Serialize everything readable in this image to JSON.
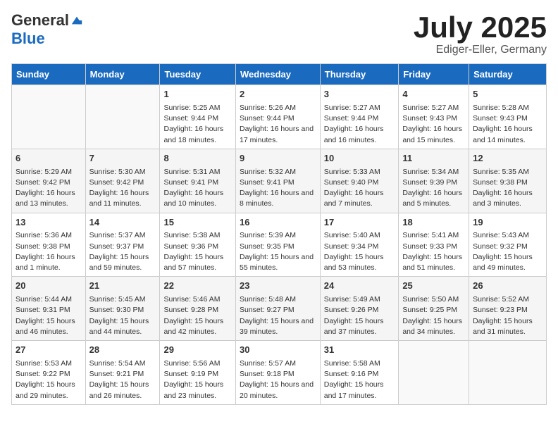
{
  "header": {
    "logo_general": "General",
    "logo_blue": "Blue",
    "title": "July 2025",
    "subtitle": "Ediger-Eller, Germany"
  },
  "days_of_week": [
    "Sunday",
    "Monday",
    "Tuesday",
    "Wednesday",
    "Thursday",
    "Friday",
    "Saturday"
  ],
  "weeks": [
    [
      {
        "day": "",
        "info": ""
      },
      {
        "day": "",
        "info": ""
      },
      {
        "day": "1",
        "info": "Sunrise: 5:25 AM\nSunset: 9:44 PM\nDaylight: 16 hours and 18 minutes."
      },
      {
        "day": "2",
        "info": "Sunrise: 5:26 AM\nSunset: 9:44 PM\nDaylight: 16 hours and 17 minutes."
      },
      {
        "day": "3",
        "info": "Sunrise: 5:27 AM\nSunset: 9:44 PM\nDaylight: 16 hours and 16 minutes."
      },
      {
        "day": "4",
        "info": "Sunrise: 5:27 AM\nSunset: 9:43 PM\nDaylight: 16 hours and 15 minutes."
      },
      {
        "day": "5",
        "info": "Sunrise: 5:28 AM\nSunset: 9:43 PM\nDaylight: 16 hours and 14 minutes."
      }
    ],
    [
      {
        "day": "6",
        "info": "Sunrise: 5:29 AM\nSunset: 9:42 PM\nDaylight: 16 hours and 13 minutes."
      },
      {
        "day": "7",
        "info": "Sunrise: 5:30 AM\nSunset: 9:42 PM\nDaylight: 16 hours and 11 minutes."
      },
      {
        "day": "8",
        "info": "Sunrise: 5:31 AM\nSunset: 9:41 PM\nDaylight: 16 hours and 10 minutes."
      },
      {
        "day": "9",
        "info": "Sunrise: 5:32 AM\nSunset: 9:41 PM\nDaylight: 16 hours and 8 minutes."
      },
      {
        "day": "10",
        "info": "Sunrise: 5:33 AM\nSunset: 9:40 PM\nDaylight: 16 hours and 7 minutes."
      },
      {
        "day": "11",
        "info": "Sunrise: 5:34 AM\nSunset: 9:39 PM\nDaylight: 16 hours and 5 minutes."
      },
      {
        "day": "12",
        "info": "Sunrise: 5:35 AM\nSunset: 9:38 PM\nDaylight: 16 hours and 3 minutes."
      }
    ],
    [
      {
        "day": "13",
        "info": "Sunrise: 5:36 AM\nSunset: 9:38 PM\nDaylight: 16 hours and 1 minute."
      },
      {
        "day": "14",
        "info": "Sunrise: 5:37 AM\nSunset: 9:37 PM\nDaylight: 15 hours and 59 minutes."
      },
      {
        "day": "15",
        "info": "Sunrise: 5:38 AM\nSunset: 9:36 PM\nDaylight: 15 hours and 57 minutes."
      },
      {
        "day": "16",
        "info": "Sunrise: 5:39 AM\nSunset: 9:35 PM\nDaylight: 15 hours and 55 minutes."
      },
      {
        "day": "17",
        "info": "Sunrise: 5:40 AM\nSunset: 9:34 PM\nDaylight: 15 hours and 53 minutes."
      },
      {
        "day": "18",
        "info": "Sunrise: 5:41 AM\nSunset: 9:33 PM\nDaylight: 15 hours and 51 minutes."
      },
      {
        "day": "19",
        "info": "Sunrise: 5:43 AM\nSunset: 9:32 PM\nDaylight: 15 hours and 49 minutes."
      }
    ],
    [
      {
        "day": "20",
        "info": "Sunrise: 5:44 AM\nSunset: 9:31 PM\nDaylight: 15 hours and 46 minutes."
      },
      {
        "day": "21",
        "info": "Sunrise: 5:45 AM\nSunset: 9:30 PM\nDaylight: 15 hours and 44 minutes."
      },
      {
        "day": "22",
        "info": "Sunrise: 5:46 AM\nSunset: 9:28 PM\nDaylight: 15 hours and 42 minutes."
      },
      {
        "day": "23",
        "info": "Sunrise: 5:48 AM\nSunset: 9:27 PM\nDaylight: 15 hours and 39 minutes."
      },
      {
        "day": "24",
        "info": "Sunrise: 5:49 AM\nSunset: 9:26 PM\nDaylight: 15 hours and 37 minutes."
      },
      {
        "day": "25",
        "info": "Sunrise: 5:50 AM\nSunset: 9:25 PM\nDaylight: 15 hours and 34 minutes."
      },
      {
        "day": "26",
        "info": "Sunrise: 5:52 AM\nSunset: 9:23 PM\nDaylight: 15 hours and 31 minutes."
      }
    ],
    [
      {
        "day": "27",
        "info": "Sunrise: 5:53 AM\nSunset: 9:22 PM\nDaylight: 15 hours and 29 minutes."
      },
      {
        "day": "28",
        "info": "Sunrise: 5:54 AM\nSunset: 9:21 PM\nDaylight: 15 hours and 26 minutes."
      },
      {
        "day": "29",
        "info": "Sunrise: 5:56 AM\nSunset: 9:19 PM\nDaylight: 15 hours and 23 minutes."
      },
      {
        "day": "30",
        "info": "Sunrise: 5:57 AM\nSunset: 9:18 PM\nDaylight: 15 hours and 20 minutes."
      },
      {
        "day": "31",
        "info": "Sunrise: 5:58 AM\nSunset: 9:16 PM\nDaylight: 15 hours and 17 minutes."
      },
      {
        "day": "",
        "info": ""
      },
      {
        "day": "",
        "info": ""
      }
    ]
  ]
}
